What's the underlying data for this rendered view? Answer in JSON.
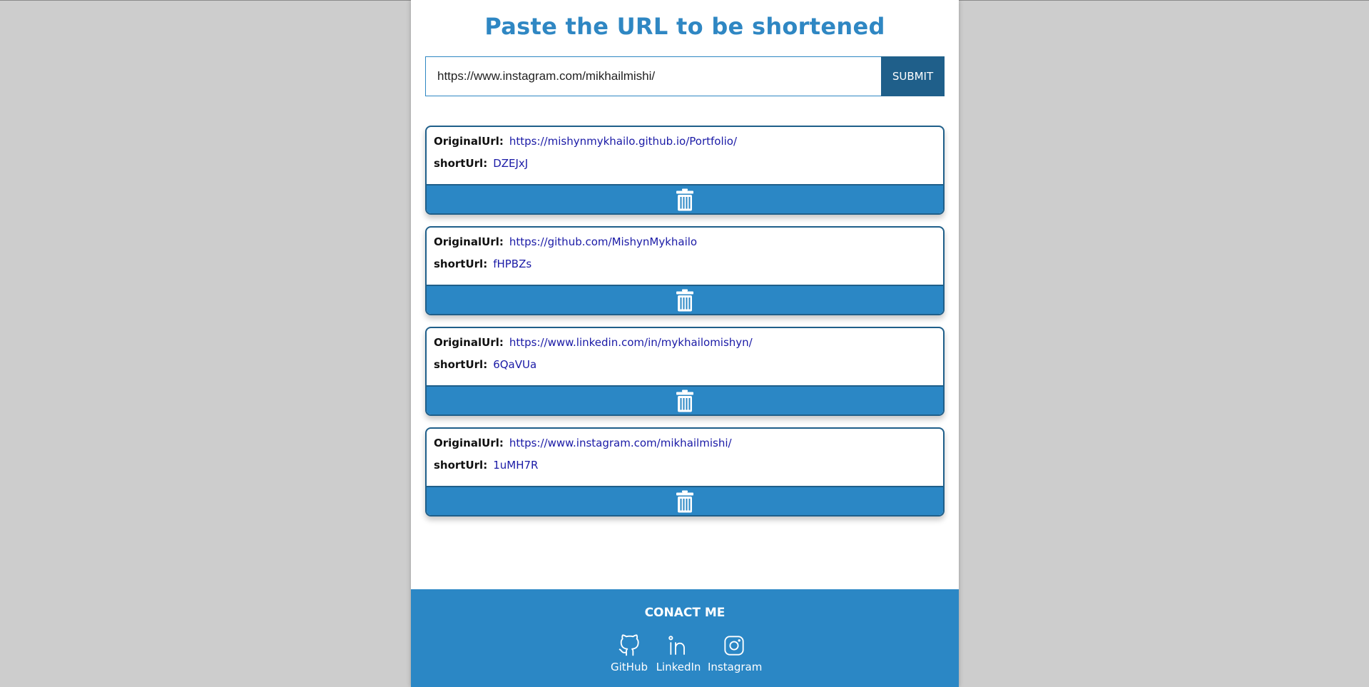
{
  "header": {
    "title": "Paste the URL to be shortened"
  },
  "form": {
    "input_value": "https://www.instagram.com/mikhailmishi/",
    "submit_label": "SUBMIT"
  },
  "labels": {
    "original": "OriginalUrl:",
    "short": "shortUrl:"
  },
  "links": [
    {
      "original": "https://mishynmykhailo.github.io/Portfolio/",
      "short": "DZEJxJ"
    },
    {
      "original": "https://github.com/MishynMykhailo",
      "short": "fHPBZs"
    },
    {
      "original": "https://www.linkedin.com/in/mykhailomishyn/",
      "short": "6QaVUa"
    },
    {
      "original": "https://www.instagram.com/mikhailmishi/",
      "short": "1uMH7R"
    }
  ],
  "footer": {
    "title": "CONACT ME",
    "socials": [
      {
        "label": "GitHub",
        "icon": "github-icon"
      },
      {
        "label": "LinkedIn",
        "icon": "linkedin-icon"
      },
      {
        "label": "Instagram",
        "icon": "instagram-icon"
      }
    ]
  },
  "colors": {
    "accent": "#2b87c5",
    "title": "#2f87c3",
    "dark_accent": "#1f5f8a",
    "link": "#1a1aa6",
    "background": "#cdcdcd"
  }
}
